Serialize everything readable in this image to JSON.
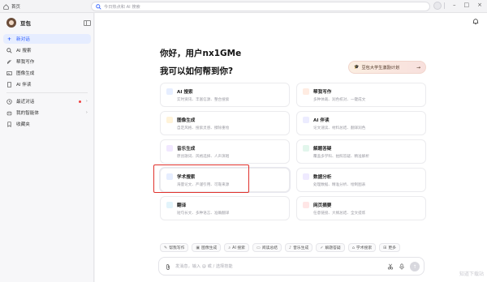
{
  "topbar": {
    "home_tab": "首页",
    "url_placeholder": "今日热点和 AI 搜索"
  },
  "sidebar": {
    "brand": "豆包",
    "items": [
      {
        "label": "新对话",
        "icon": "plus-icon",
        "active": true
      },
      {
        "label": "AI 搜索",
        "icon": "search-icon"
      },
      {
        "label": "帮我写作",
        "icon": "pen-icon"
      },
      {
        "label": "图像生成",
        "icon": "image-icon"
      },
      {
        "label": "AI 伴读",
        "icon": "book-icon"
      }
    ],
    "section_items": [
      {
        "label": "最近对话",
        "icon": "clock-icon"
      },
      {
        "label": "我的智能体",
        "icon": "bot-icon"
      },
      {
        "label": "收藏夹",
        "icon": "bookmark-icon"
      }
    ]
  },
  "main": {
    "greeting": "你好，用户nx1GMe",
    "subtitle": "我可以如何帮到你?",
    "plan_button": "豆包大学生激励计划",
    "cards": [
      {
        "title": "AI 搜索",
        "desc": "实时资讯、丰富信源、整合搜索",
        "icon_color": "#3d7bff"
      },
      {
        "title": "帮我写作",
        "desc": "多种体裁、润色校对、一键成文",
        "icon_color": "#ff7a45"
      },
      {
        "title": "图像生成",
        "desc": "自定风格、搜索灵感、擦除重绘",
        "icon_color": "#ffb020"
      },
      {
        "title": "AI 伴读",
        "desc": "论文速读、材料总结、翻译润色",
        "icon_color": "#6b6bff"
      },
      {
        "title": "音乐生成",
        "desc": "原创歌词、风格选择、人声演唱",
        "icon_color": "#9c5cff"
      },
      {
        "title": "解题答疑",
        "desc": "覆盖多学科、拍照答疑、精准解析",
        "icon_color": "#34b27b"
      },
      {
        "title": "学术搜索",
        "desc": "海量论文、严谨引用、可靠来源",
        "icon_color": "#3d7bff"
      },
      {
        "title": "数据分析",
        "desc": "处理数据、精准分析、绘制图表",
        "icon_color": "#7a5cff"
      },
      {
        "title": "翻译",
        "desc": "短句长文、多种语言、准确翻译",
        "icon_color": "#2aa8d8"
      },
      {
        "title": "网页摘要",
        "desc": "任意链接、大纲总结、全文提炼",
        "icon_color": "#ff5c5c"
      }
    ],
    "quick_chips": [
      "帮我写作",
      "图像生成",
      "AI 搜索",
      "阅读总结",
      "音乐生成",
      "解题答疑",
      "学术搜索",
      "更多"
    ],
    "composer_placeholder": "发消息，输入 @ 或 / 选择技能",
    "watermark": "知道下载站"
  }
}
